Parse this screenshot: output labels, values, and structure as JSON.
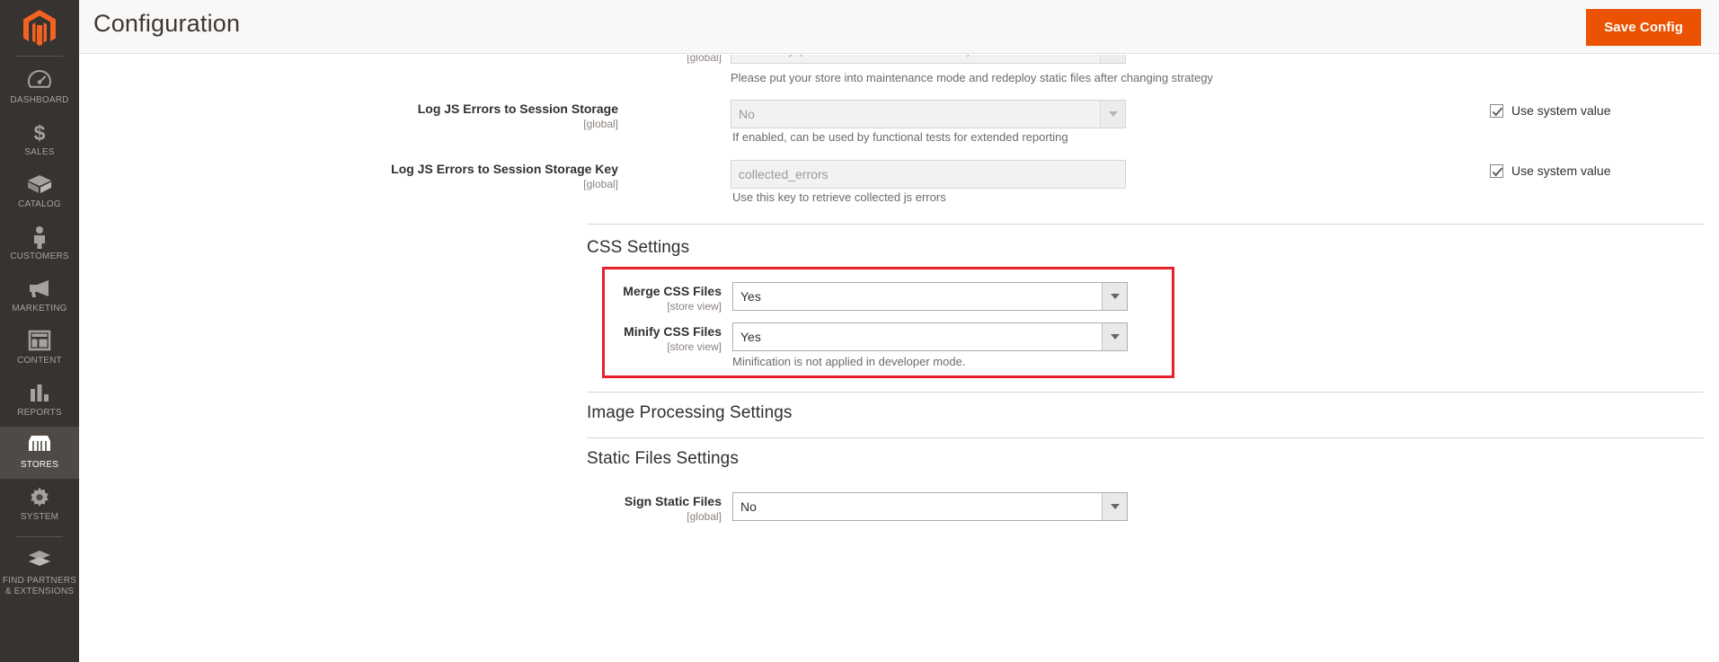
{
  "sidebar": {
    "logo": "magento-logo-icon",
    "items": [
      {
        "label": "DASHBOARD",
        "icon": "dashboard-icon",
        "active": false
      },
      {
        "label": "SALES",
        "icon": "sales-dollar-icon",
        "active": false
      },
      {
        "label": "CATALOG",
        "icon": "catalog-box-icon",
        "active": false
      },
      {
        "label": "CUSTOMERS",
        "icon": "customers-person-icon",
        "active": false
      },
      {
        "label": "MARKETING",
        "icon": "marketing-megaphone-icon",
        "active": false
      },
      {
        "label": "CONTENT",
        "icon": "content-layout-icon",
        "active": false
      },
      {
        "label": "REPORTS",
        "icon": "reports-bar-chart-icon",
        "active": false
      },
      {
        "label": "STORES",
        "icon": "stores-storefront-icon",
        "active": true
      },
      {
        "label": "SYSTEM",
        "icon": "system-gear-icon",
        "active": false
      }
    ],
    "footer_item": {
      "label_line1": "FIND PARTNERS",
      "label_line2": "& EXTENSIONS",
      "icon": "extensions-blocks-icon"
    }
  },
  "header": {
    "title": "Configuration",
    "save_label": "Save Config",
    "accent_color": "#eb5202"
  },
  "use_system_value_label": "Use system value",
  "fields": {
    "translation_strategy": {
      "scope": "[global]",
      "value": "Dictionary (Translation on Storefront side)",
      "hint": "Please put your store into maintenance mode and redeploy static files after changing strategy",
      "use_system_value": true,
      "disabled": true
    },
    "log_js_errors": {
      "label": "Log JS Errors to Session Storage",
      "scope": "[global]",
      "value": "No",
      "hint": "If enabled, can be used by functional tests for extended reporting",
      "use_system_value": true,
      "disabled": true
    },
    "log_js_errors_key": {
      "label": "Log JS Errors to Session Storage Key",
      "scope": "[global]",
      "value": "collected_errors",
      "hint": "Use this key to retrieve collected js errors",
      "use_system_value": true,
      "disabled": true
    },
    "merge_css": {
      "label": "Merge CSS Files",
      "scope": "[store view]",
      "value": "Yes",
      "disabled": false
    },
    "minify_css": {
      "label": "Minify CSS Files",
      "scope": "[store view]",
      "value": "Yes",
      "hint": "Minification is not applied in developer mode.",
      "disabled": false
    },
    "sign_static_files": {
      "label": "Sign Static Files",
      "scope": "[global]",
      "value": "No",
      "disabled": false
    }
  },
  "sections": {
    "css_settings": {
      "title": "CSS Settings",
      "expanded": true,
      "chevron": "chevron-up-icon"
    },
    "image_processing": {
      "title": "Image Processing Settings",
      "expanded": false,
      "chevron": "chevron-down-icon"
    },
    "static_files": {
      "title": "Static Files Settings",
      "expanded": true,
      "chevron": "chevron-up-icon"
    }
  },
  "highlight": {
    "color": "#e8202a"
  }
}
